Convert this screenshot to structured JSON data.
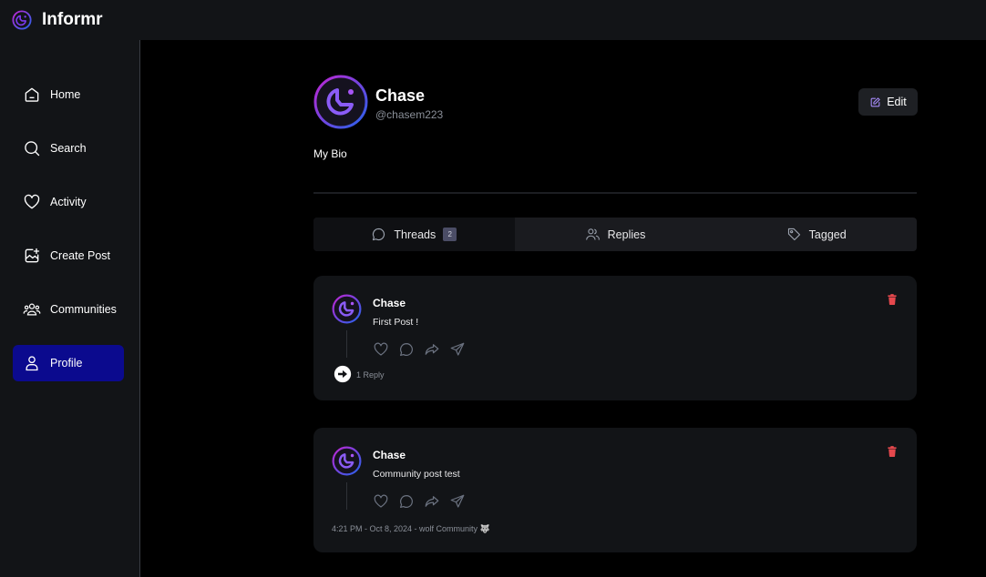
{
  "app": {
    "title": "Informr"
  },
  "sidebar": {
    "items": [
      {
        "label": "Home",
        "icon": "home-icon"
      },
      {
        "label": "Search",
        "icon": "search-icon"
      },
      {
        "label": "Activity",
        "icon": "heart-icon"
      },
      {
        "label": "Create Post",
        "icon": "create-post-icon"
      },
      {
        "label": "Communities",
        "icon": "communities-icon"
      },
      {
        "label": "Profile",
        "icon": "user-icon",
        "active": true
      }
    ]
  },
  "profile": {
    "name": "Chase",
    "handle": "@chasem223",
    "bio": "My Bio",
    "edit_label": "Edit"
  },
  "tabs": [
    {
      "label": "Threads",
      "count": "2",
      "active": true,
      "icon": "chat-bubble-icon"
    },
    {
      "label": "Replies",
      "icon": "users-icon"
    },
    {
      "label": "Tagged",
      "icon": "tag-icon"
    }
  ],
  "threads": [
    {
      "author": "Chase",
      "text": "First Post !",
      "replies": "1 Reply"
    },
    {
      "author": "Chase",
      "text": "Community post test",
      "meta": "4:21 PM - Oct 8, 2024 - wolf Community 🐺"
    }
  ],
  "colors": {
    "accent": "#0b0a8e",
    "panel": "#121417",
    "delete": "#e5484d",
    "avatar_gradient": [
      "#c026d3",
      "#2563eb"
    ]
  }
}
